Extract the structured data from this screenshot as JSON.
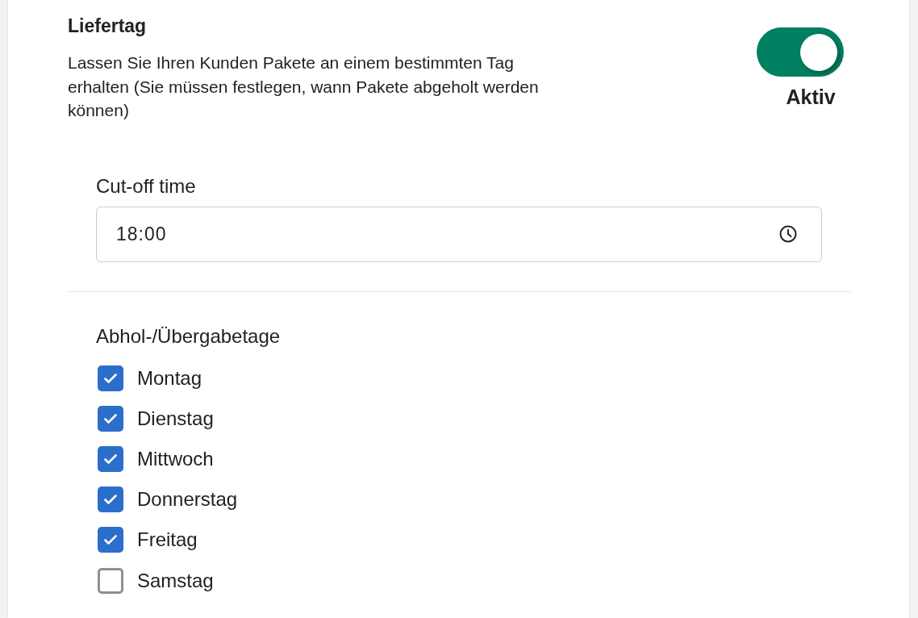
{
  "section": {
    "title": "Liefertag",
    "description": "Lassen Sie Ihren Kunden Pakete an einem bestimmten Tag erhalten (Sie müssen festlegen, wann Pakete abgeholt werden können)",
    "toggle": {
      "on": true,
      "label": "Aktiv"
    }
  },
  "cutoff": {
    "label": "Cut-off time",
    "value": "18:00"
  },
  "pickup_days": {
    "label": "Abhol-/Übergabetage",
    "days": [
      {
        "label": "Montag",
        "checked": true
      },
      {
        "label": "Dienstag",
        "checked": true
      },
      {
        "label": "Mittwoch",
        "checked": true
      },
      {
        "label": "Donnerstag",
        "checked": true
      },
      {
        "label": "Freitag",
        "checked": true
      },
      {
        "label": "Samstag",
        "checked": false
      }
    ]
  }
}
